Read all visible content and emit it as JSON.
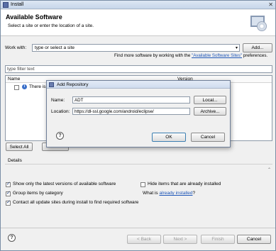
{
  "window": {
    "title": "Install",
    "close_glyph": "✕"
  },
  "header": {
    "title": "Available Software",
    "subtitle": "Select a site or enter the location of a site."
  },
  "work_with": {
    "label": "Work with:",
    "value": "type or select a site",
    "add_label": "Add...",
    "find_more_prefix": "Find more software by working with the ",
    "find_more_link": "\"Available Software Sites\"",
    "find_more_suffix": " preferences."
  },
  "filter": {
    "value": "type filter text"
  },
  "tree": {
    "columns": [
      "Name",
      "Version"
    ],
    "rows": [
      {
        "text": "There is n"
      }
    ]
  },
  "buttons": {
    "select_all": "Select All"
  },
  "details": {
    "label": "Details"
  },
  "options": {
    "latest_versions": {
      "label": "Show only the latest versions of available software",
      "checked": true
    },
    "hide_installed": {
      "label": "Hide items that are already installed",
      "checked": false
    },
    "group_by_category": {
      "label": "Group items by category",
      "checked": true
    },
    "what_is": {
      "prefix": "What is ",
      "link": "already installed",
      "suffix": "?"
    },
    "contact_sites": {
      "label": "Contact all update sites during install to find required software",
      "checked": true
    }
  },
  "footer": {
    "back": "< Back",
    "next": "Next >",
    "finish": "Finish",
    "cancel": "Cancel"
  },
  "dialog": {
    "title": "Add Repository",
    "name_label": "Name:",
    "name_value": "ADT",
    "local_label": "Local...",
    "location_label": "Location:",
    "location_value": "https://dl-ssl.google.com/android/eclipse/",
    "archive_label": "Archive...",
    "ok_label": "OK",
    "cancel_label": "Cancel"
  },
  "icons": {
    "help": "?",
    "info": "i",
    "combo_arrow": "▾",
    "scroll": "⌃"
  }
}
